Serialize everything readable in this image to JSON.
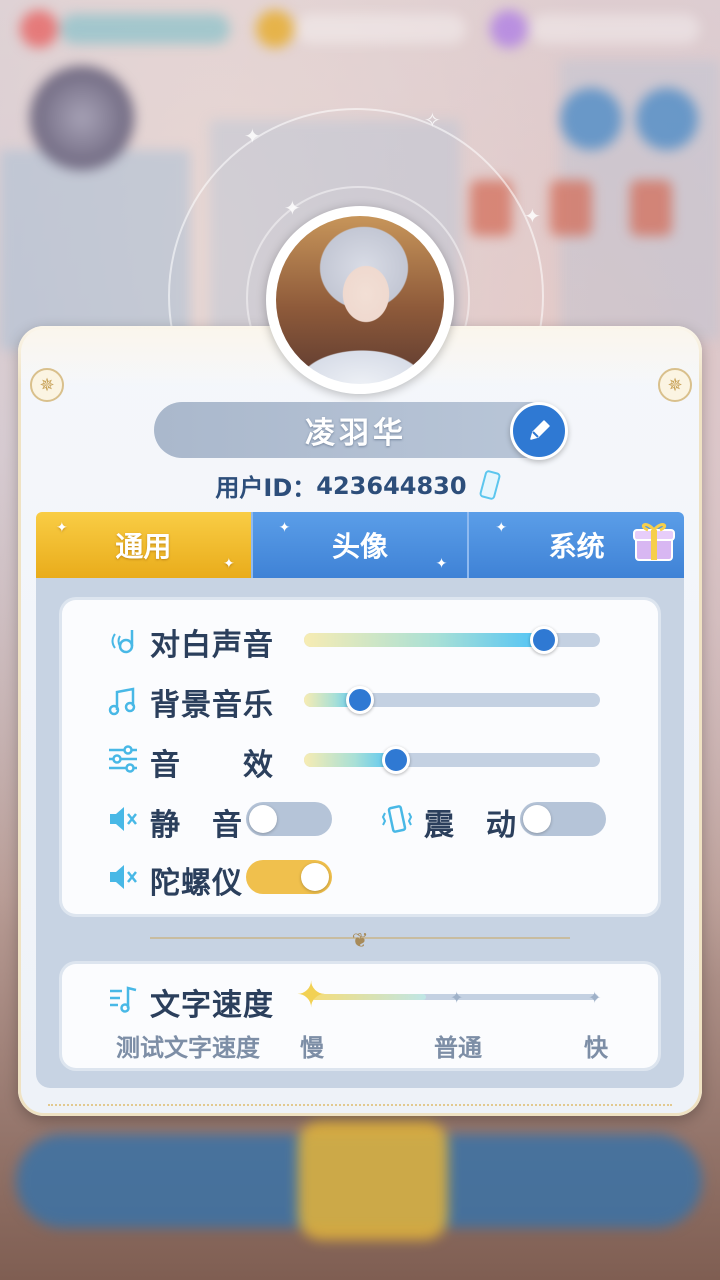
{
  "profile": {
    "name": "凌羽华",
    "uid_label": "用户ID：",
    "uid_value": "423644830"
  },
  "tabs": [
    {
      "label": "通用",
      "active": true
    },
    {
      "label": "头像",
      "active": false
    },
    {
      "label": "系统",
      "active": false
    }
  ],
  "settings": {
    "dialogue_voice": {
      "label": "对白声音",
      "value": 0.81
    },
    "bgm": {
      "label": "背景音乐",
      "value": 0.19
    },
    "sfx": {
      "label": "音　　效",
      "value": 0.31
    },
    "mute": {
      "label": "静　音",
      "on": false
    },
    "vibration": {
      "label": "震　动",
      "on": false
    },
    "gyroscope": {
      "label": "陀螺仪",
      "on": true
    }
  },
  "text_speed": {
    "label": "文字速度",
    "test_label": "测试文字速度",
    "options": [
      "慢",
      "普通",
      "快"
    ],
    "selected": "慢"
  },
  "colors": {
    "accent_blue": "#2f79d3",
    "accent_gold": "#f0c04d",
    "label_text": "#2b3f5c"
  },
  "icons": {
    "edit": "pencil-icon",
    "copy": "phone-copy-icon",
    "gift": "gift-icon",
    "voice": "voice-wave-icon",
    "music": "music-note-icon",
    "sfx": "equalizer-icon",
    "mute": "speaker-mute-icon",
    "vibrate": "vibrate-icon",
    "text_speed": "text-speed-icon"
  }
}
